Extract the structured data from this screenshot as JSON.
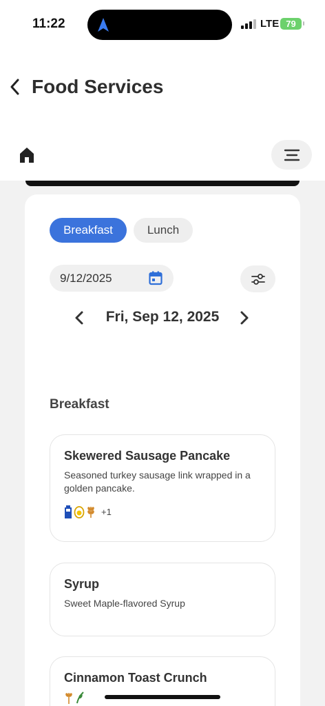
{
  "status": {
    "time": "11:22",
    "network": "LTE",
    "battery": "79"
  },
  "header": {
    "title": "Food Services"
  },
  "meal_tabs": [
    {
      "label": "Breakfast",
      "selected": true
    },
    {
      "label": "Lunch",
      "selected": false
    }
  ],
  "date_picker": {
    "value": "9/12/2025"
  },
  "day_nav": {
    "label": "Fri, Sep 12, 2025"
  },
  "section": {
    "title": "Breakfast"
  },
  "items": [
    {
      "name": "Skewered Sausage Pancake",
      "description": "Seasoned turkey sausage link wrapped in a golden pancake.",
      "allergens": [
        "milk-icon",
        "egg-icon",
        "wheat-icon"
      ],
      "more": "+1"
    },
    {
      "name": "Syrup",
      "description": "Sweet Maple-flavored Syrup"
    },
    {
      "name": "Cinnamon Toast Crunch",
      "allergens": [
        "wheat-icon",
        "soy-icon"
      ]
    }
  ],
  "colors": {
    "accent": "#3b73dc",
    "battery": "#6cd16c"
  }
}
